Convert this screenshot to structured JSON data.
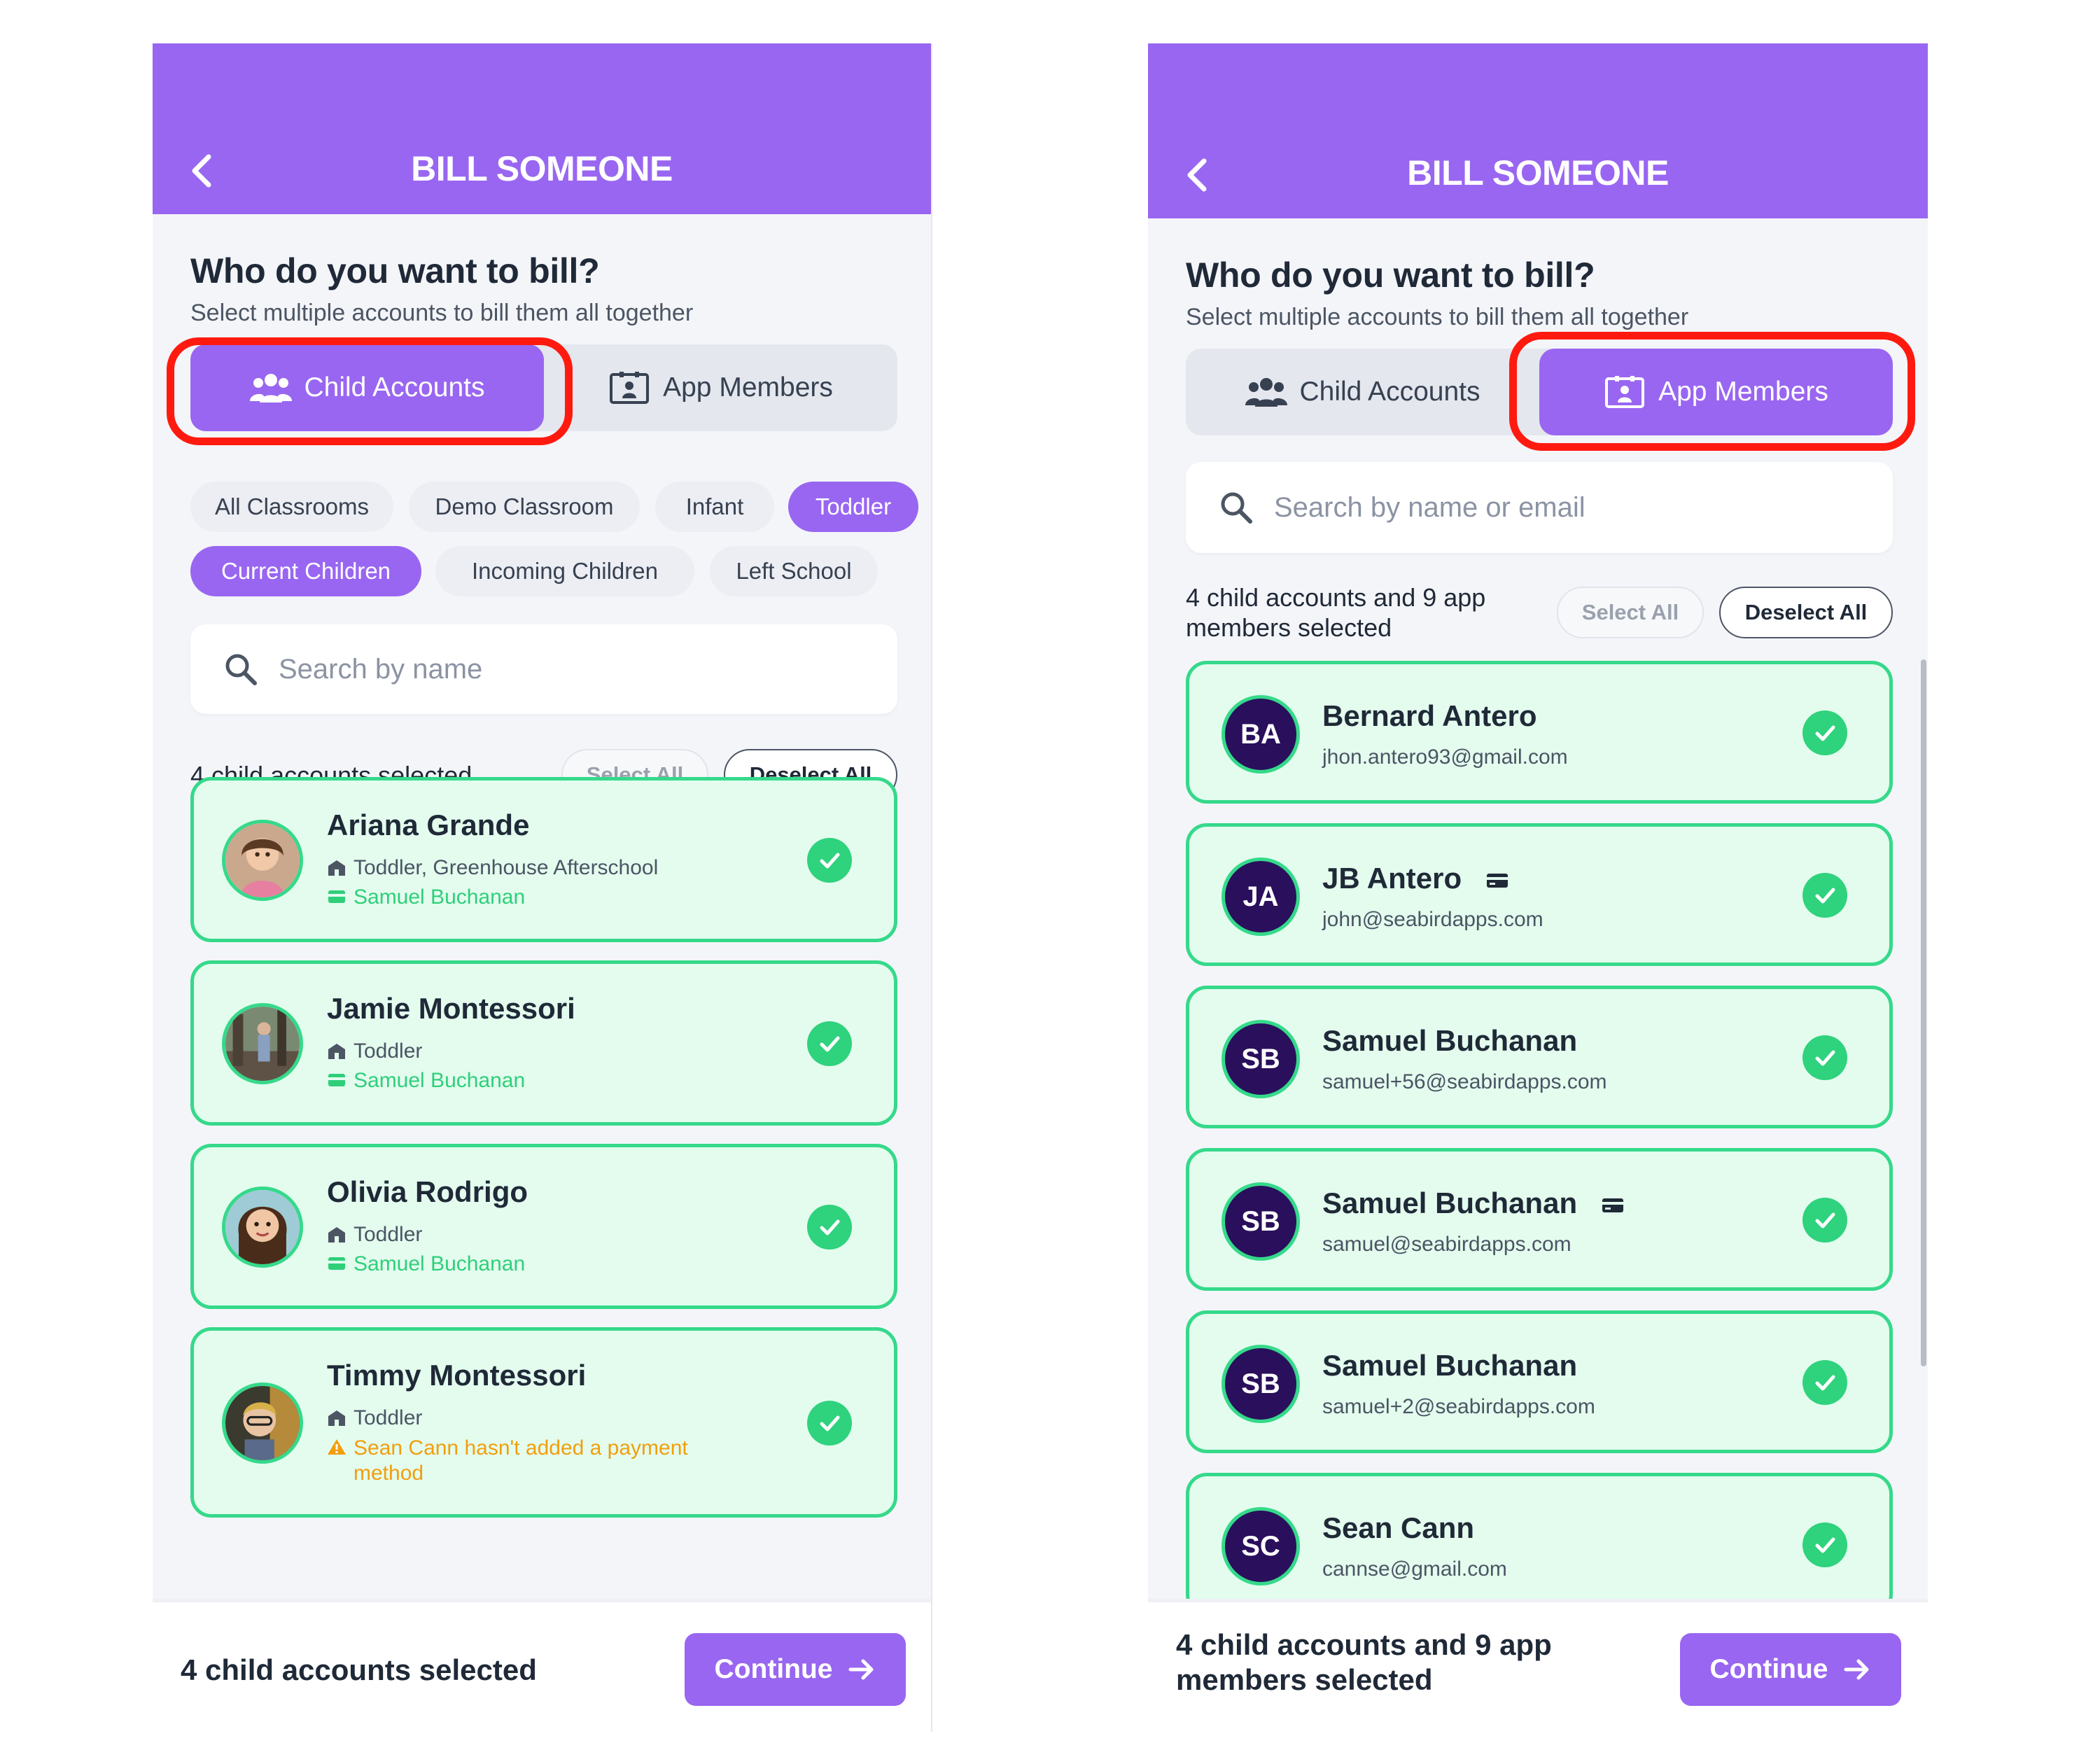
{
  "colors": {
    "accent": "#9966f1",
    "selected_bg": "#e3fcee",
    "selected_border": "#35d98a",
    "highlight": "#ff1a10",
    "warning": "#f29e0c",
    "avatar_bg": "#2a0f5c"
  },
  "left": {
    "header": {
      "title": "BILL SOMEONE",
      "back_icon": "chevron-left-icon"
    },
    "question": "Who do you want to bill?",
    "subtitle": "Select multiple accounts to bill them all together",
    "tabs": [
      {
        "label": "Child Accounts",
        "icon": "users-icon",
        "active": true
      },
      {
        "label": "App Members",
        "icon": "id-badge-icon",
        "active": false
      }
    ],
    "classroom_filters": [
      {
        "label": "All Classrooms",
        "active": false
      },
      {
        "label": "Demo Classroom",
        "active": false
      },
      {
        "label": "Infant",
        "active": false
      },
      {
        "label": "Toddler",
        "active": true
      }
    ],
    "status_filters": [
      {
        "label": "Current Children",
        "active": true
      },
      {
        "label": "Incoming Children",
        "active": false
      },
      {
        "label": "Left School",
        "active": false
      }
    ],
    "search": {
      "placeholder": "Search by name"
    },
    "selection": {
      "count_label": "4 child accounts selected",
      "select_all": "Select All",
      "deselect_all": "Deselect All"
    },
    "children": [
      {
        "name": "Ariana Grande",
        "classroom": "Toddler, Greenhouse Afterschool",
        "payer": "Samuel Buchanan",
        "selected": true
      },
      {
        "name": "Jamie Montessori",
        "classroom": "Toddler",
        "payer": "Samuel Buchanan",
        "selected": true
      },
      {
        "name": "Olivia Rodrigo",
        "classroom": "Toddler",
        "payer": "Samuel Buchanan",
        "selected": true
      },
      {
        "name": "Timmy Montessori",
        "classroom": "Toddler",
        "warning": "Sean Cann hasn't added a payment method",
        "selected": true
      }
    ],
    "footer": {
      "summary": "4 child accounts selected",
      "continue": "Continue"
    }
  },
  "right": {
    "header": {
      "title": "BILL SOMEONE",
      "back_icon": "chevron-left-icon"
    },
    "question": "Who do you want to bill?",
    "subtitle": "Select multiple accounts to bill them all together",
    "tabs": [
      {
        "label": "Child Accounts",
        "icon": "users-icon",
        "active": false
      },
      {
        "label": "App Members",
        "icon": "id-badge-icon",
        "active": true
      }
    ],
    "search": {
      "placeholder": "Search by name or email"
    },
    "selection": {
      "count_label": "4 child accounts and 9 app members selected",
      "select_all": "Select All",
      "deselect_all": "Deselect All"
    },
    "members": [
      {
        "initials": "BA",
        "name": "Bernard Antero",
        "email": "jhon.antero93@gmail.com",
        "has_card": false,
        "selected": true
      },
      {
        "initials": "JA",
        "name": "JB Antero",
        "email": "john@seabirdapps.com",
        "has_card": true,
        "selected": true
      },
      {
        "initials": "SB",
        "name": "Samuel Buchanan",
        "email": "samuel+56@seabirdapps.com",
        "has_card": false,
        "selected": true
      },
      {
        "initials": "SB",
        "name": "Samuel Buchanan",
        "email": "samuel@seabirdapps.com",
        "has_card": true,
        "selected": true
      },
      {
        "initials": "SB",
        "name": "Samuel Buchanan",
        "email": "samuel+2@seabirdapps.com",
        "has_card": false,
        "selected": true
      },
      {
        "initials": "SC",
        "name": "Sean Cann",
        "email": "cannse@gmail.com",
        "has_card": false,
        "selected": true
      }
    ],
    "footer": {
      "summary": "4 child accounts and 9 app members selected",
      "continue": "Continue"
    }
  }
}
